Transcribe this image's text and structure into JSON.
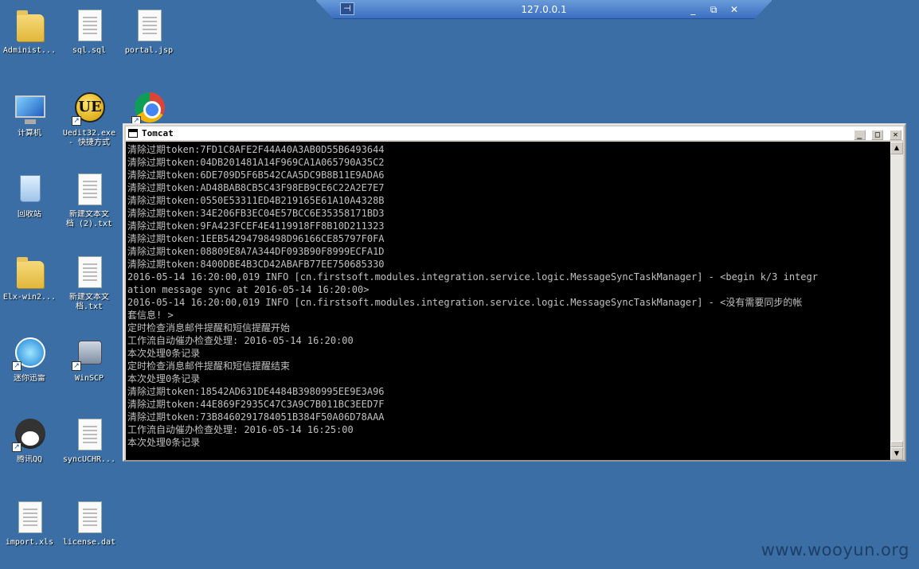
{
  "rdp": {
    "title": "127.0.0.1",
    "pin": "⊣",
    "minimize": "_",
    "restore": "⧉",
    "close": "✕"
  },
  "desktop": {
    "icons": [
      {
        "label": "Administ..."
      },
      {
        "label": "sql.sql"
      },
      {
        "label": "portal.jsp"
      },
      {
        "label": "计算机"
      },
      {
        "label": "Uedit32.exe\n- 快捷方式",
        "glyph": "UE"
      },
      {
        "label": "Google Chrome"
      },
      {
        "label": "回收站"
      },
      {
        "label": "新建文本文\n档 (2).txt"
      },
      {
        "label": "Elx-win2..."
      },
      {
        "label": "新建文本文\n档.txt"
      },
      {
        "label": "迷你迅雷"
      },
      {
        "label": "WinSCP"
      },
      {
        "label": "腾讯QQ"
      },
      {
        "label": "syncUCHR..."
      },
      {
        "label": "import.xls"
      },
      {
        "label": "license.dat"
      }
    ]
  },
  "console": {
    "title": "Tomcat",
    "buttons": {
      "minimize": "_",
      "maximize": "□",
      "close": "✕"
    },
    "lines": [
      "清除过期token:7FD1C8AFE2F44A40A3AB0D55B6493644",
      "清除过期token:04DB201481A14F969CA1A065790A35C2",
      "清除过期token:6DE709D5F6B542CAA5DC9B8B11E9ADA6",
      "清除过期token:AD48BAB8CB5C43F98EB9CE6C22A2E7E7",
      "清除过期token:0550E53311ED4B219165E61A10A4328B",
      "清除过期token:34E206FB3EC04E57BCC6E35358171BD3",
      "清除过期token:9FA423FCEF4E4119918FF8B10D211323",
      "清除过期token:1EEB54294798498D96166CE85797F0FA",
      "清除过期token:08809E8A7A344DF093B90F8999ECFA1D",
      "清除过期token:8400DBE4B3CD42ABAFB77EE750685330",
      "2016-05-14 16:20:00,019 INFO [cn.firstsoft.modules.integration.service.logic.MessageSyncTaskManager] - <begin k/3 integr",
      "ation message sync at 2016-05-14 16:20:00>",
      "2016-05-14 16:20:00,019 INFO [cn.firstsoft.modules.integration.service.logic.MessageSyncTaskManager] - <没有需要同步的帐",
      "套信息! >",
      "定时检查消息邮件提醒和短信提醒开始",
      "工作流自动催办检查处理: 2016-05-14 16:20:00",
      "本次处理0条记录",
      "定时检查消息邮件提醒和短信提醒结束",
      "本次处理0条记录",
      "清除过期token:18542AD631DE4484B3980995EE9E3A96",
      "清除过期token:44E869F2935C47C3A9C7B011BC3EED7F",
      "清除过期token:73B8460291784051B384F50A06D78AAA",
      "工作流自动催办检查处理: 2016-05-14 16:25:00",
      "本次处理0条记录"
    ]
  },
  "watermark": "www.wooyun.org"
}
